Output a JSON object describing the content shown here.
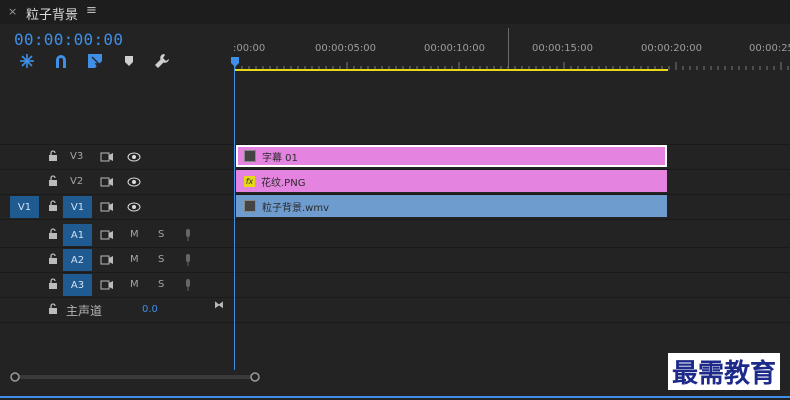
{
  "panel": {
    "close": "×",
    "title": "粒子背景",
    "menu": "≡"
  },
  "timecode": "00:00:00:00",
  "tools": [
    {
      "name": "snap-icon"
    },
    {
      "name": "linked-selection-icon"
    },
    {
      "name": "add-marker-icon"
    },
    {
      "name": "marker-icon"
    },
    {
      "name": "wrench-icon"
    }
  ],
  "ruler": [
    ":00:00",
    "00:00:05:00",
    "00:00:10:00",
    "00:00:15:00",
    "00:00:20:00",
    "00:00:25"
  ],
  "video_tracks": [
    {
      "source": "",
      "name": "V3"
    },
    {
      "source": "",
      "name": "V2"
    },
    {
      "source": "V1",
      "name": "V1"
    }
  ],
  "audio_tracks": [
    {
      "name": "A1",
      "m": "M",
      "s": "S"
    },
    {
      "name": "A2",
      "m": "M",
      "s": "S"
    },
    {
      "name": "A3",
      "m": "M",
      "s": "S"
    }
  ],
  "master": {
    "label": "主声道",
    "value": "0.0"
  },
  "clips": [
    {
      "name": "字幕 01",
      "color": "#e583e0"
    },
    {
      "name": "花纹.PNG",
      "color": "#e583e0"
    },
    {
      "name": "粒子背景.wmv",
      "color": "#6f9ccf"
    }
  ],
  "watermark": "最需教育",
  "colors": {
    "accent": "#3f8fe6",
    "track_target": "#1f5a91",
    "workarea": "#e8d916"
  }
}
